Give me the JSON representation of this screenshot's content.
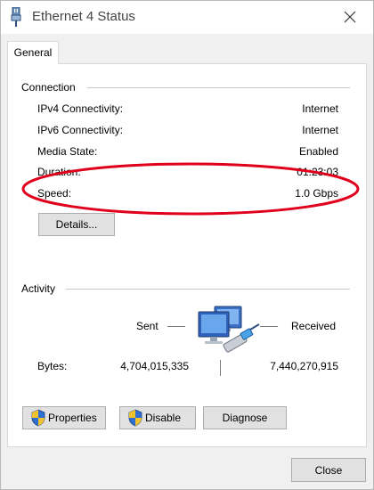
{
  "window": {
    "title": "Ethernet 4 Status",
    "title_icon": "ethernet-adapter-icon",
    "close_icon": "close-icon"
  },
  "tabs": [
    {
      "label": "General",
      "selected": true
    }
  ],
  "connection": {
    "heading": "Connection",
    "rows": [
      {
        "label": "IPv4 Connectivity:",
        "value": "Internet"
      },
      {
        "label": "IPv6 Connectivity:",
        "value": "Internet"
      },
      {
        "label": "Media State:",
        "value": "Enabled"
      },
      {
        "label": "Duration:",
        "value": "01:23:03"
      },
      {
        "label": "Speed:",
        "value": "1.0 Gbps"
      }
    ],
    "details_button": "Details...",
    "highlight_color": "#e0001b"
  },
  "activity": {
    "heading": "Activity",
    "sent_label": "Sent",
    "received_label": "Received",
    "bytes_label": "Bytes:",
    "bytes_sent": "4,704,015,335",
    "bytes_received": "7,440,270,915",
    "icon": "network-computers-icon"
  },
  "buttons": {
    "properties": "Properties",
    "disable": "Disable",
    "diagnose": "Diagnose",
    "close": "Close",
    "shield_icon": "uac-shield-icon"
  }
}
